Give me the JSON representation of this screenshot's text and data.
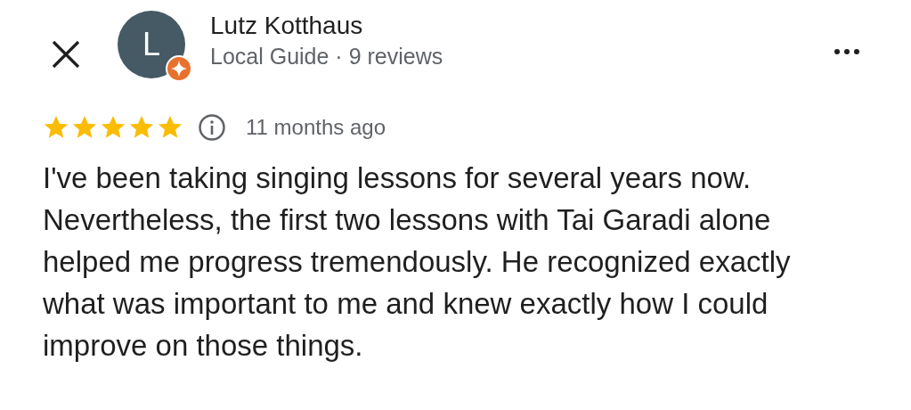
{
  "author": {
    "avatar_letter": "L",
    "local_guide_badge": true,
    "name": "Lutz Kotthaus",
    "subtitle": "Local Guide · 9 reviews"
  },
  "rating": {
    "stars": 5,
    "time": "11 months ago"
  },
  "review_text": "I've been taking singing lessons for several years now. Nevertheless, the first two lessons with Tai Garadi alone helped me progress tremendously. He recognized exactly what was important to me and knew exactly how I could improve on those things."
}
